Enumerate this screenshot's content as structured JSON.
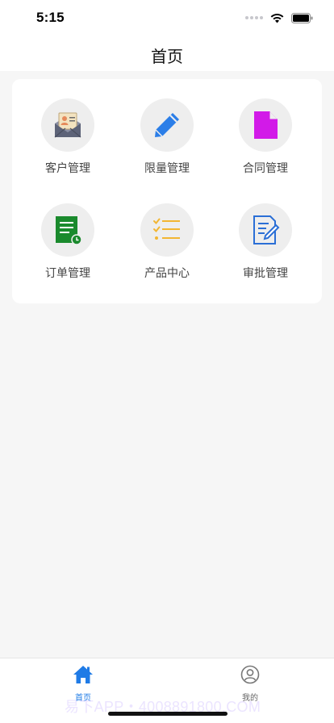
{
  "status_bar": {
    "time": "5:15",
    "wifi_icon": "wifi-icon",
    "battery_icon": "battery-icon"
  },
  "header": {
    "title": "首页"
  },
  "grid": {
    "items": [
      {
        "label": "客户管理",
        "icon": "customer-mail-icon"
      },
      {
        "label": "限量管理",
        "icon": "pencil-icon"
      },
      {
        "label": "合同管理",
        "icon": "document-icon"
      },
      {
        "label": "订单管理",
        "icon": "order-list-icon"
      },
      {
        "label": "产品中心",
        "icon": "checklist-icon"
      },
      {
        "label": "审批管理",
        "icon": "approval-edit-icon"
      }
    ]
  },
  "tab_bar": {
    "tabs": [
      {
        "label": "首页",
        "icon": "home-icon",
        "active": true
      },
      {
        "label": "我的",
        "icon": "profile-icon",
        "active": false
      }
    ],
    "active_color": "#1f7be6",
    "inactive_color": "#666666"
  },
  "watermark": "易下APP・4008891800.COM"
}
